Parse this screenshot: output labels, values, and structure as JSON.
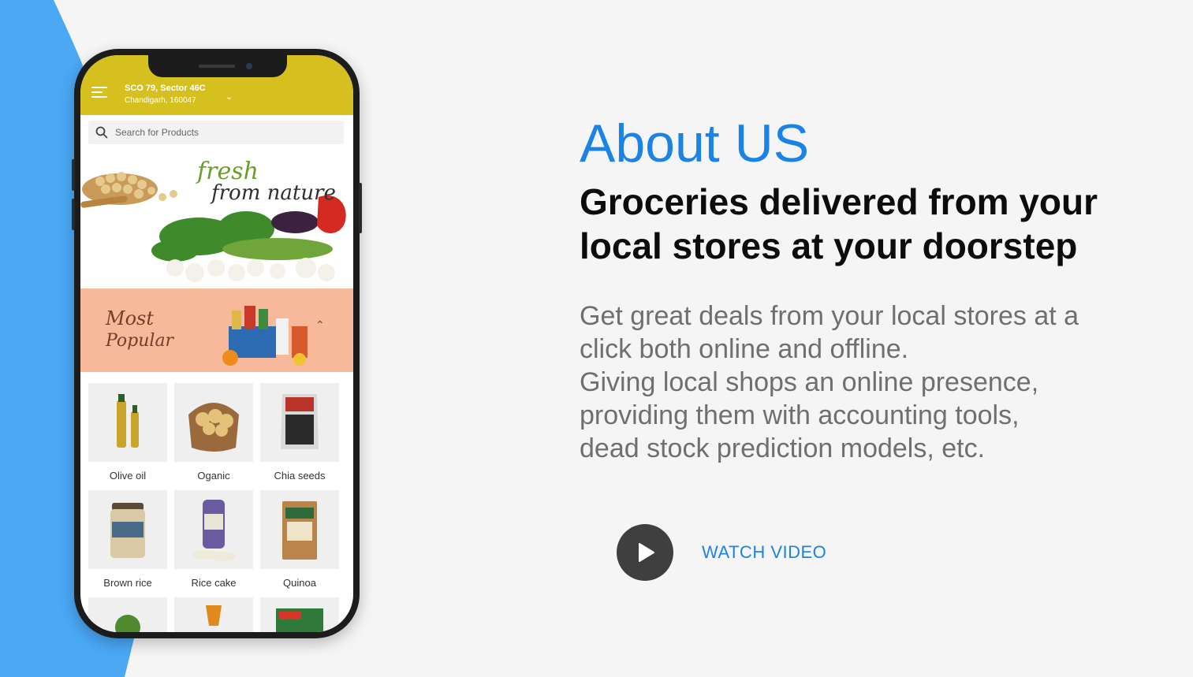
{
  "colors": {
    "background": "#f5f5f5",
    "accent_blue": "#1b83e6",
    "side_shape_blue": "#4aa8f5",
    "app_header_yellow": "#d6c01f",
    "popular_peach": "#f8b99a",
    "play_button": "#3f3f3f"
  },
  "phone": {
    "header": {
      "menu_icon": "hamburger-menu-icon",
      "address_line1": "SCO 79, Sector 46C",
      "address_line2": "Chandigarh, 160047",
      "dropdown_icon": "chevron-down-icon"
    },
    "search": {
      "icon": "search-icon",
      "placeholder": "Search for Products"
    },
    "banner": {
      "text_line1": "fresh",
      "text_line2": "from nature"
    },
    "popular": {
      "title_line1": "Most",
      "title_line2": "Popular",
      "toggle_icon": "chevron-up-icon"
    },
    "products": [
      {
        "label": "Olive oil"
      },
      {
        "label": "Oganic"
      },
      {
        "label": "Chia seeds"
      },
      {
        "label": "Brown rice"
      },
      {
        "label": "Rice cake"
      },
      {
        "label": "Quinoa"
      }
    ]
  },
  "about": {
    "title": "About US",
    "subtitle_line1": "Groceries delivered from your",
    "subtitle_line2": "local stores at your doorstep",
    "desc_line1": "Get great deals from your local stores at a",
    "desc_line2": "click both online and offline.",
    "desc_line3": "Giving local shops an online presence,",
    "desc_line4": "providing them with accounting tools,",
    "desc_line5": "dead stock prediction models, etc."
  },
  "video": {
    "icon": "play-icon",
    "label": "WATCH VIDEO"
  }
}
